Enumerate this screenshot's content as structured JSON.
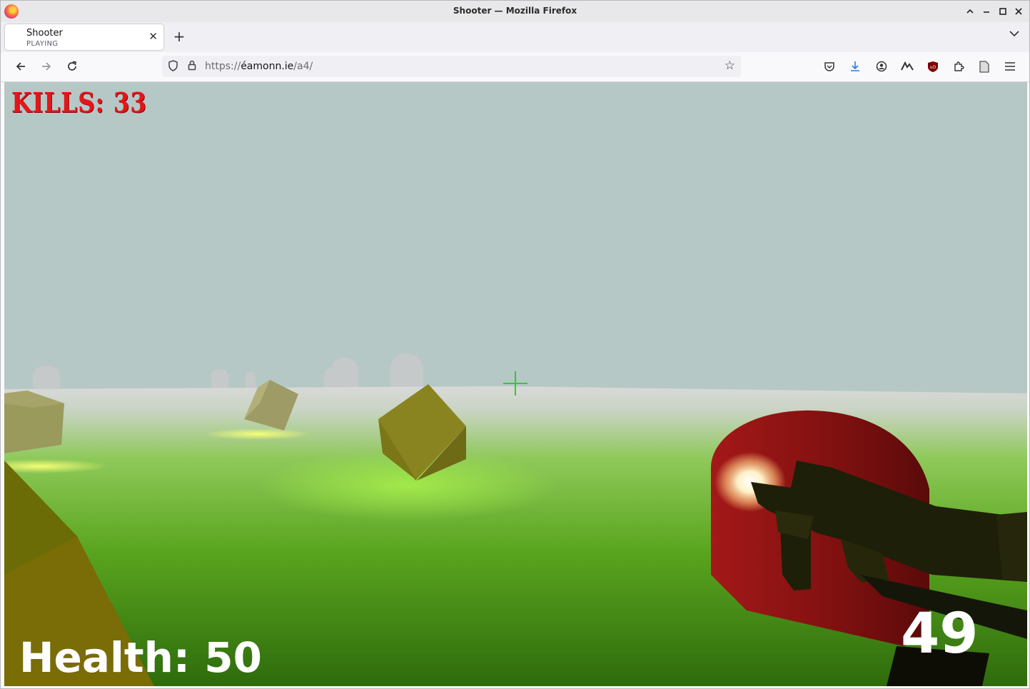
{
  "window": {
    "title": "Shooter — Mozilla Firefox"
  },
  "tab": {
    "title": "Shooter",
    "subtitle": "PLAYING"
  },
  "address": {
    "prefix": "https://",
    "host": "éamonn.ie",
    "path": "/a4/"
  },
  "icons": {
    "back": "back-arrow-icon",
    "forward": "forward-arrow-icon",
    "reload": "reload-icon",
    "bookmark": "star-icon"
  },
  "hud": {
    "kills_text": "KILLS: 33",
    "kills": 33,
    "health_text": "Health: 50",
    "health": 50,
    "ammo": "49"
  },
  "colors": {
    "kills": "#e3161a",
    "crosshair": "#2ad11f",
    "sky": "#b5c8c6",
    "ground": "#5caa18",
    "crate": "#8a8420",
    "enemy": "#8e1414"
  }
}
